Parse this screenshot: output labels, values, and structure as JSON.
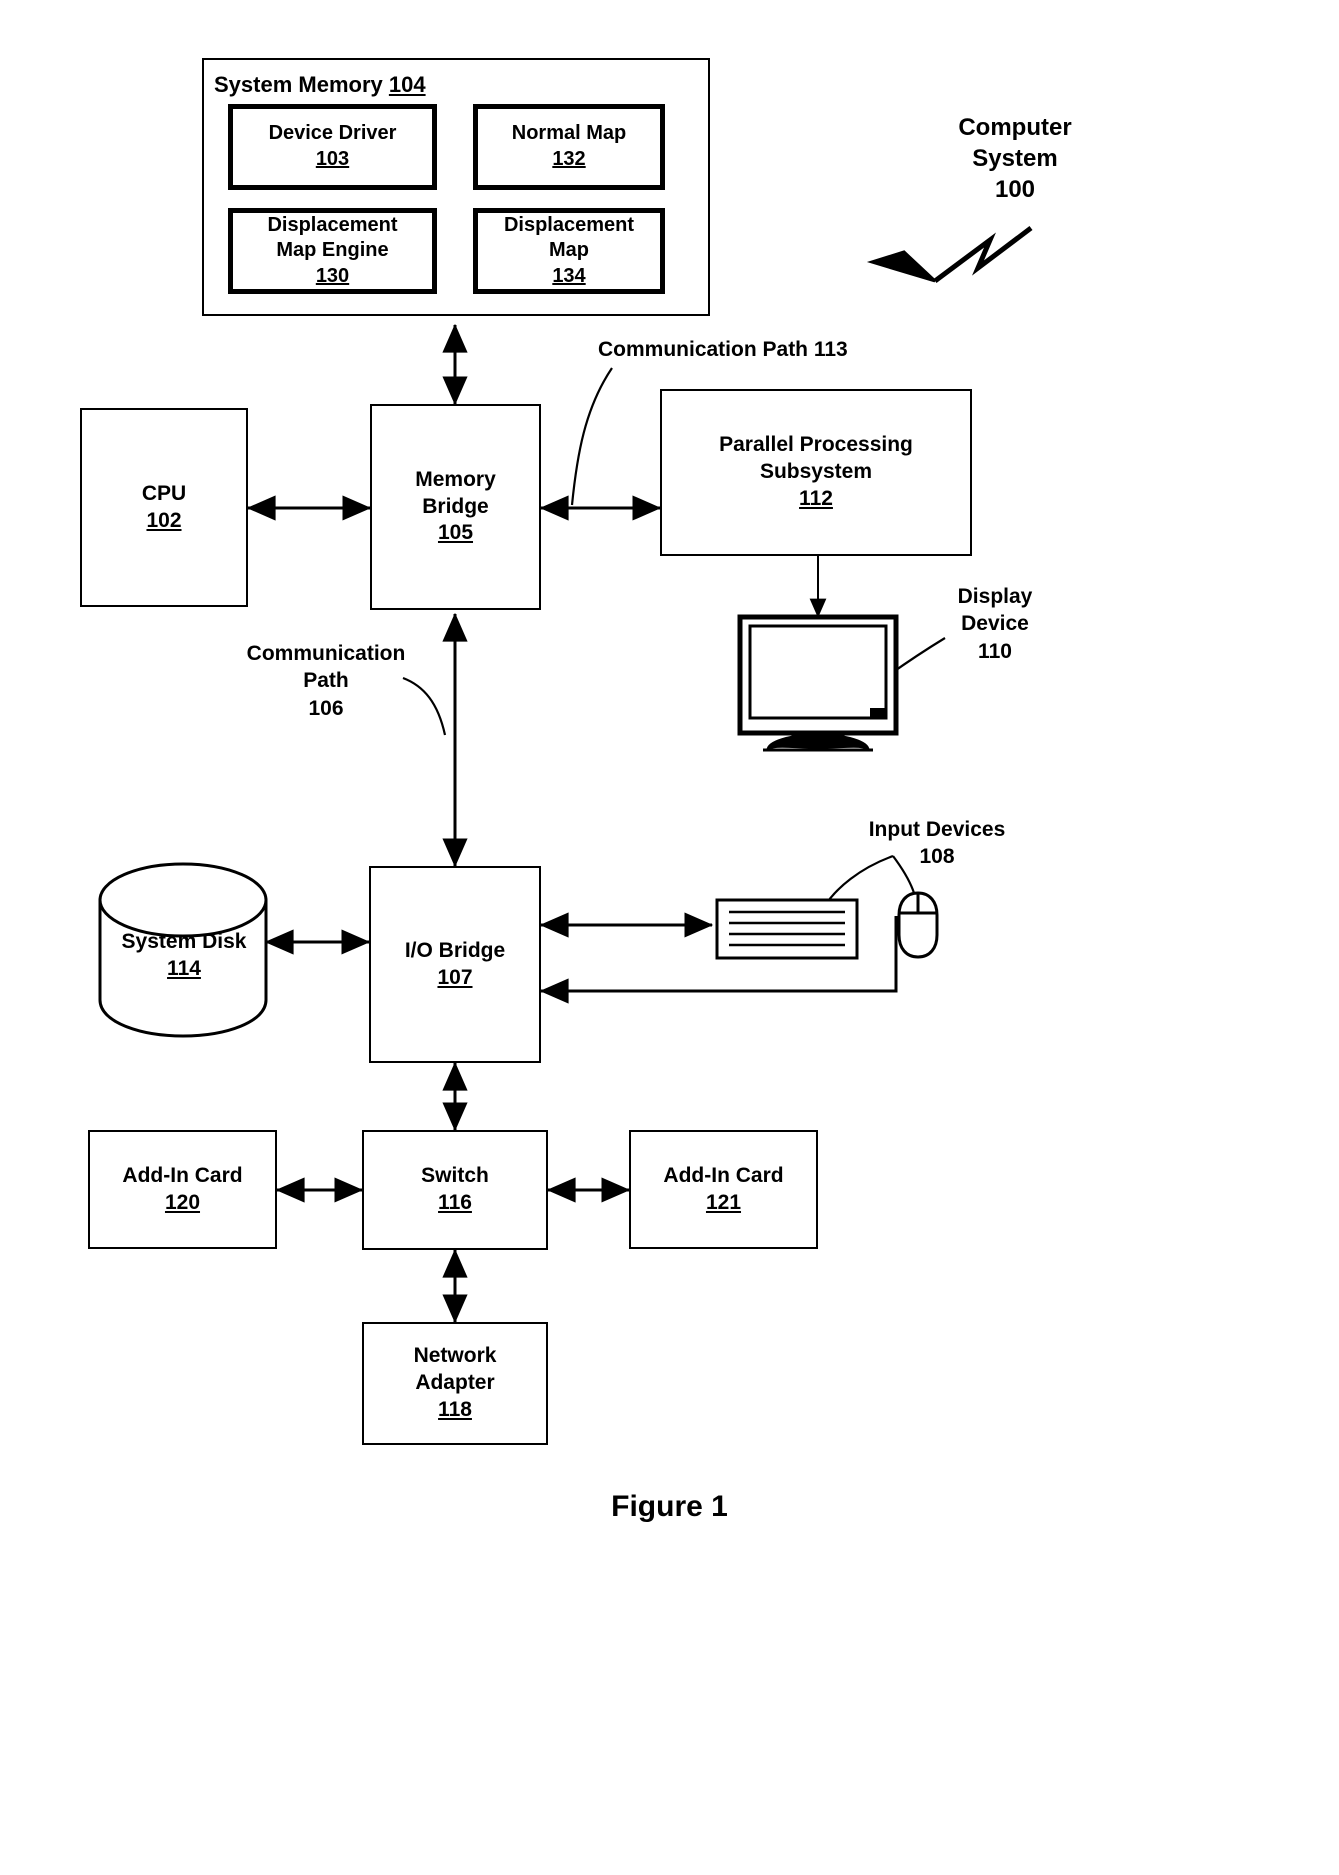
{
  "figure": {
    "caption": "Figure 1",
    "callout": {
      "line1": "Computer",
      "line2": "System",
      "line3": "100"
    }
  },
  "system_memory": {
    "title_text": "System Memory",
    "title_num": "104",
    "blocks": [
      {
        "name": "device-driver",
        "line1": "Device Driver",
        "line2": "",
        "num": "103"
      },
      {
        "name": "normal-map",
        "line1": "Normal Map",
        "line2": "",
        "num": "132"
      },
      {
        "name": "displacement-map-engine",
        "line1": "Displacement",
        "line2": "Map Engine",
        "num": "130"
      },
      {
        "name": "displacement-map",
        "line1": "Displacement",
        "line2": "Map",
        "num": "134"
      }
    ]
  },
  "blocks": {
    "cpu": {
      "line1": "CPU",
      "line2": "",
      "num": "102"
    },
    "memory_bridge": {
      "line1": "Memory",
      "line2": "Bridge",
      "num": "105"
    },
    "pps": {
      "line1": "Parallel Processing",
      "line2": "Subsystem",
      "num": "112"
    },
    "io_bridge": {
      "line1": "I/O Bridge",
      "line2": "",
      "num": "107"
    },
    "system_disk": {
      "line1": "System Disk",
      "line2": "",
      "num": "114"
    },
    "switch": {
      "line1": "Switch",
      "line2": "",
      "num": "116"
    },
    "add_in_card_120": {
      "line1": "Add-In Card",
      "line2": "",
      "num": "120"
    },
    "add_in_card_121": {
      "line1": "Add-In Card",
      "line2": "",
      "num": "121"
    },
    "network_adapter": {
      "line1": "Network",
      "line2": "Adapter",
      "num": "118"
    }
  },
  "labels": {
    "comm_path_113": {
      "line1": "Communication Path 113"
    },
    "comm_path_106": {
      "line1": "Communication",
      "line2": "Path",
      "line3": "106"
    },
    "display_device": {
      "line1": "Display",
      "line2": "Device",
      "line3": "110"
    },
    "input_devices": {
      "line1": "Input Devices",
      "line2": "108"
    }
  },
  "icons": {
    "monitor": "monitor-icon",
    "keyboard": "keyboard-icon",
    "mouse": "mouse-icon",
    "disk": "disk-cylinder-icon",
    "lightning": "lightning-pointer-icon"
  },
  "colors": {
    "ink": "#000000",
    "paper": "#ffffff"
  }
}
